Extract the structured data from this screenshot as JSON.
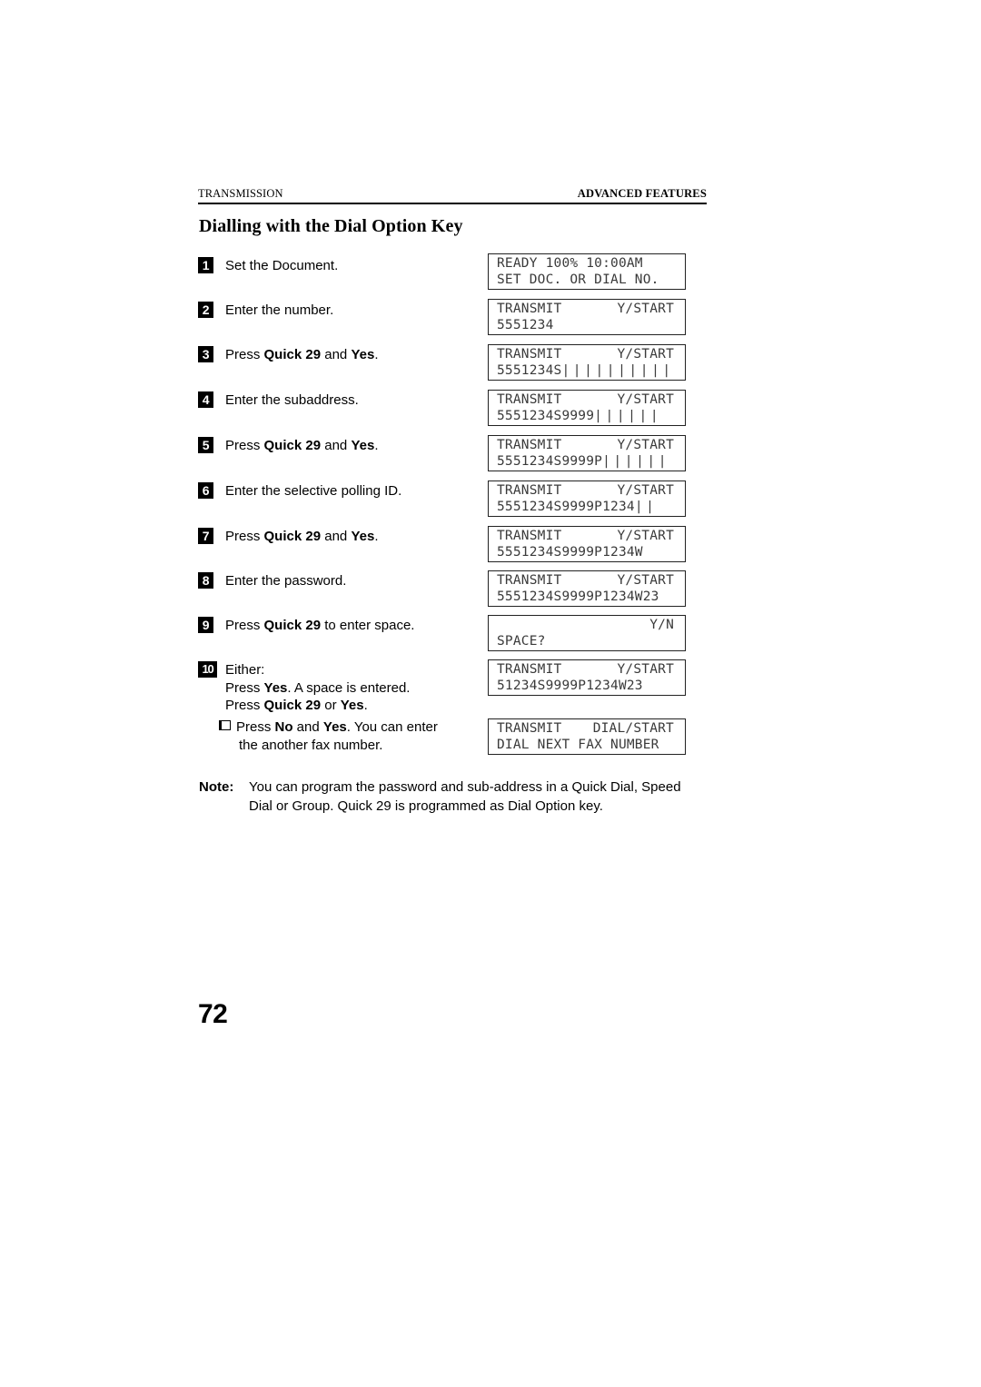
{
  "header": {
    "left": "TRANSMISSION",
    "right": "ADVANCED FEATURES"
  },
  "title": "Dialling with the Dial Option Key",
  "steps": [
    {
      "number": "1",
      "text_html": "Set the Document.",
      "display": {
        "line1_left": "READY 100% 10:00AM",
        "line2_left": "SET DOC. OR DIAL NO."
      }
    },
    {
      "number": "2",
      "text_html": "Enter the number.",
      "display": {
        "line1_left": "TRANSMIT",
        "line1_right": "Y/START",
        "line2_left": "5551234"
      }
    },
    {
      "number": "3",
      "text_html": "Press <b>Quick 29</b> and <b>Yes</b>.",
      "display": {
        "line1_left": "TRANSMIT",
        "line1_right": "Y/START",
        "line2_left": "5551234S",
        "line2_cursors": "||||||||||"
      }
    },
    {
      "number": "4",
      "text_html": "Enter the subaddress.",
      "display": {
        "line1_left": "TRANSMIT",
        "line1_right": "Y/START",
        "line2_left": "5551234S9999",
        "line2_cursors": "||||||"
      }
    },
    {
      "number": "5",
      "text_html": "Press <b>Quick 29</b> and <b>Yes</b>.",
      "display": {
        "line1_left": "TRANSMIT",
        "line1_right": "Y/START",
        "line2_left": "5551234S9999P",
        "line2_cursors": "||||||"
      }
    },
    {
      "number": "6",
      "text_html": "Enter the selective polling ID.",
      "display": {
        "line1_left": "TRANSMIT",
        "line1_right": "Y/START",
        "line2_left": "5551234S9999P1234",
        "line2_cursors": "||"
      }
    },
    {
      "number": "7",
      "text_html": "Press <b>Quick 29</b> and <b>Yes</b>.",
      "display": {
        "line1_left": "TRANSMIT",
        "line1_right": "Y/START",
        "line2_left": "5551234S9999P1234W"
      }
    },
    {
      "number": "8",
      "text_html": "Enter the password.",
      "display": {
        "line1_left": "TRANSMIT",
        "line1_right": "Y/START",
        "line2_left": "5551234S9999P1234W23"
      }
    },
    {
      "number": "9",
      "text_html": "Press <b>Quick 29</b> to enter space.",
      "display": {
        "line1_right_only": "Y/N",
        "line2_left": "SPACE?"
      }
    },
    {
      "number": "10",
      "text_html": "Either:<br>Press <b>Yes</b>. A space is entered.<br>Press <b>Quick 29</b> or <b>Yes</b>.",
      "display": {
        "line1_left": "TRANSMIT",
        "line1_right": "Y/START",
        "line2_left": "51234S9999P1234W23"
      }
    }
  ],
  "sub_item": {
    "bullet_icon": "hollow-square-bullet",
    "line1_html": "Press <b>No</b> and <b>Yes</b>. You can enter",
    "line2_html": "the another fax number.",
    "display": {
      "line1_left": "TRANSMIT",
      "line1_right": "DIAL/START",
      "line2_left": "DIAL NEXT FAX NUMBER"
    }
  },
  "note": {
    "label": "Note:",
    "line1": "You can program the password and sub-address in a Quick Dial, Speed",
    "line2": "Dial or Group. Quick 29 is programmed as Dial Option key."
  },
  "page_number": "72"
}
